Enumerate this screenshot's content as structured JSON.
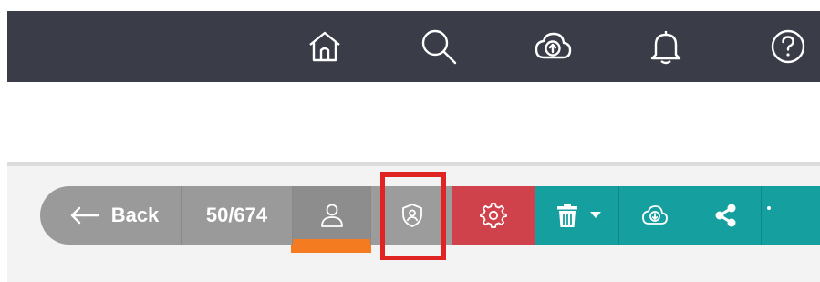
{
  "topbar": {
    "icons": [
      "home-icon",
      "search-icon",
      "cloud-upload-icon",
      "bell-icon",
      "help-icon"
    ],
    "background": "#3a3d48"
  },
  "toolbar": {
    "back_label": "Back",
    "pager": "50/674",
    "buttons": [
      "person-icon",
      "shield-user-icon",
      "gear-icon",
      "trash-icon",
      "cloud-download-icon",
      "share-icon"
    ],
    "colors": {
      "gray": "#9a9a9a",
      "red": "#d0424b",
      "teal": "#159f9f",
      "active_underline": "#f47b20",
      "highlight": "#e02424"
    }
  }
}
